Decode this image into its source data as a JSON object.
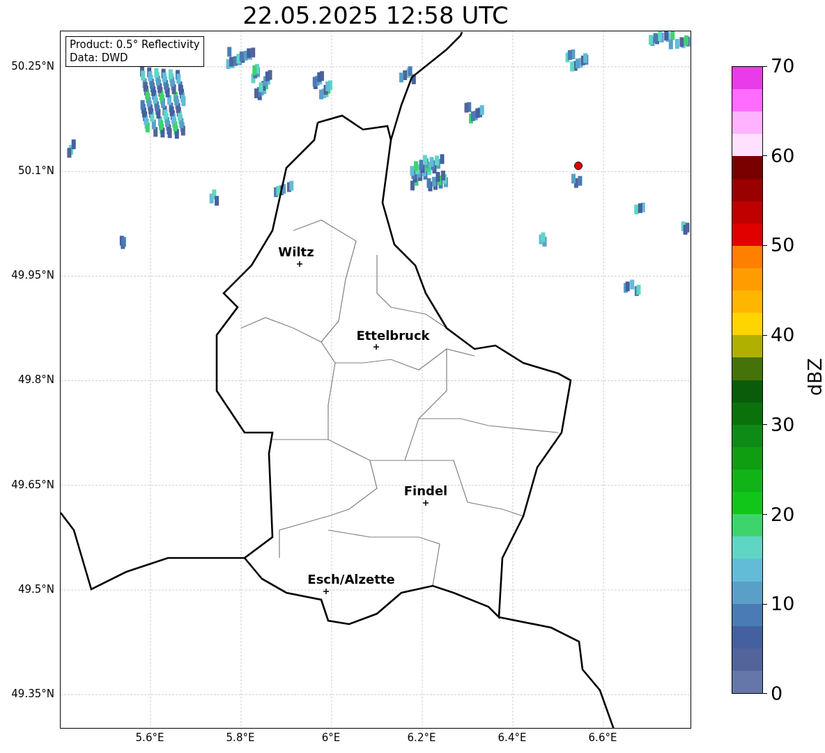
{
  "title": "22.05.2025 12:58 UTC",
  "legend": [
    "Product: 0.5° Reflectivity",
    "Data: DWD"
  ],
  "cities": [
    {
      "name": "Wiltz"
    },
    {
      "name": "Ettelbruck"
    },
    {
      "name": "Findel"
    },
    {
      "name": "Esch/Alzette"
    }
  ],
  "xticks": [
    "5.6°E",
    "5.8°E",
    "6°E",
    "6.2°E",
    "6.4°E",
    "6.6°E"
  ],
  "yticks": [
    "50.25°N",
    "50.1°N",
    "49.95°N",
    "49.8°N",
    "49.65°N",
    "49.5°N",
    "49.35°N"
  ],
  "colorbar": {
    "label": "dBZ",
    "ticks": [
      "70",
      "60",
      "50",
      "40",
      "30",
      "20",
      "10",
      "0"
    ],
    "segments": [
      {
        "color": "#e93be9"
      },
      {
        "color": "#ff6cff"
      },
      {
        "color": "#ffb3ff"
      },
      {
        "color": "#ffe1ff"
      },
      {
        "color": "#7a0000"
      },
      {
        "color": "#9a0000"
      },
      {
        "color": "#bf0000"
      },
      {
        "color": "#e00000"
      },
      {
        "color": "#ff7f00"
      },
      {
        "color": "#ff9d00"
      },
      {
        "color": "#ffb600"
      },
      {
        "color": "#ffd500"
      },
      {
        "color": "#b0b000"
      },
      {
        "color": "#467309"
      },
      {
        "color": "#0a5c0a"
      },
      {
        "color": "#0b720b"
      },
      {
        "color": "#0e8a16"
      },
      {
        "color": "#0f9e12"
      },
      {
        "color": "#10b417"
      },
      {
        "color": "#10c618"
      },
      {
        "color": "#3dd46c"
      },
      {
        "color": "#5fd6c4"
      },
      {
        "color": "#62bcd8"
      },
      {
        "color": "#5a9fc8"
      },
      {
        "color": "#4b7bb4"
      },
      {
        "color": "#4560a0"
      },
      {
        "color": "#52649a"
      },
      {
        "color": "#6577a8"
      }
    ]
  }
}
